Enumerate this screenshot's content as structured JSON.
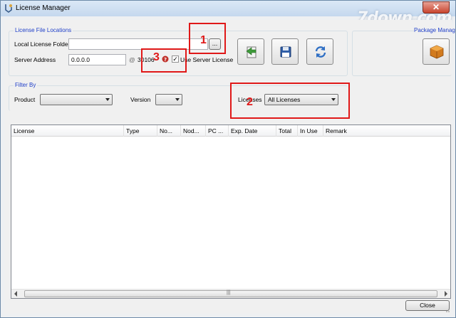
{
  "window": {
    "title": "License Manager",
    "close_glyph": "✕",
    "watermark": "7down.com"
  },
  "locations": {
    "group_title": "License File Locations",
    "local_folder_label": "Local License Folder",
    "local_folder_value": "",
    "browse_label": "...",
    "server_address_label": "Server Address",
    "server_address_value": "0.0.0.0",
    "at_symbol": "@",
    "port_value": "30106",
    "use_server_label": "Use Server License",
    "use_server_checked": true
  },
  "toolbar": {
    "buttons": [
      "import-icon",
      "save-icon",
      "refresh-icon"
    ]
  },
  "package_manager": {
    "label": "Package Manag"
  },
  "filter": {
    "group_title": "Filter By",
    "product_label": "Product",
    "product_value": "",
    "version_label": "Version",
    "version_value": "",
    "licenses_label": "Licenses",
    "licenses_value": "All Licenses"
  },
  "annotations": [
    "1",
    "2",
    "3"
  ],
  "table": {
    "columns": [
      "License",
      "Type",
      "No...",
      "Nod...",
      "PC ...",
      "Exp. Date",
      "Total",
      "In Use",
      "Remark"
    ],
    "scroll_grip": "|||"
  },
  "footer": {
    "close_label": "Close"
  },
  "colors": {
    "group_title": "#1e3ec8",
    "annotation": "#e01818"
  }
}
